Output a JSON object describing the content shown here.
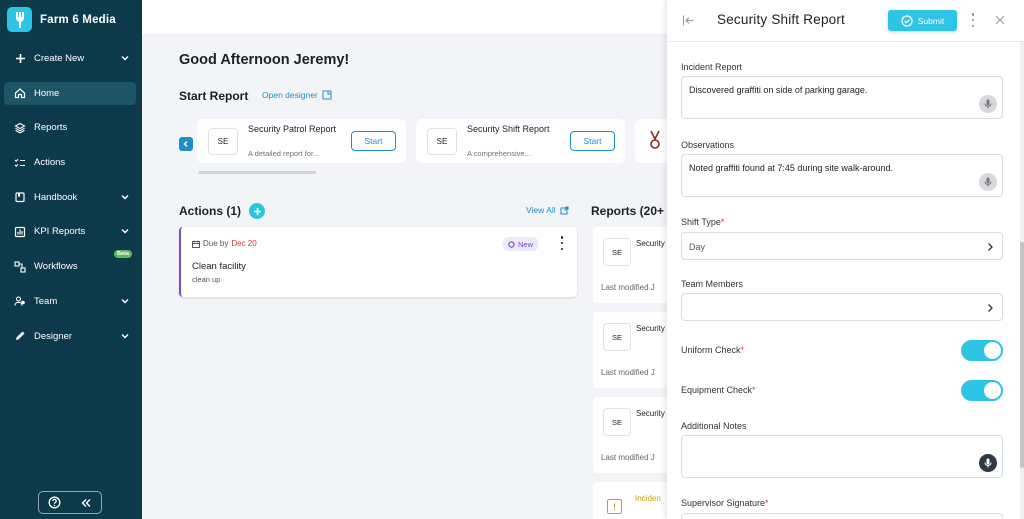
{
  "brand": {
    "name": "Farm 6 Media"
  },
  "sidebar": {
    "items": [
      {
        "label": "Create New",
        "icon": "plus-icon",
        "has_chevron": true
      },
      {
        "label": "Home",
        "icon": "home-icon",
        "active": true
      },
      {
        "label": "Reports",
        "icon": "layers-icon"
      },
      {
        "label": "Actions",
        "icon": "checklist-icon"
      },
      {
        "label": "Handbook",
        "icon": "book-icon",
        "has_chevron": true
      },
      {
        "label": "KPI Reports",
        "icon": "chart-icon",
        "has_chevron": true
      },
      {
        "label": "Workflows",
        "icon": "workflow-icon",
        "badge": "Beta"
      },
      {
        "label": "Team",
        "icon": "team-icon",
        "has_chevron": true
      },
      {
        "label": "Designer",
        "icon": "pencil-icon",
        "has_chevron": true
      }
    ]
  },
  "main": {
    "greeting": "Good Afternoon Jeremy!",
    "start_report": {
      "heading": "Start Report",
      "open_designer": "Open designer",
      "cards": [
        {
          "badge": "SE",
          "title": "Security Patrol Report",
          "desc": "A detailed report for...",
          "button": "Start"
        },
        {
          "badge": "SE",
          "title": "Security Shift Report",
          "desc": "A comprehensive...",
          "button": "Start"
        }
      ]
    },
    "actions": {
      "heading": "Actions (1)",
      "view_all": "View All",
      "card": {
        "due_prefix": "Due by",
        "due_date": "Dec 20",
        "status": "New",
        "title": "Clean facility",
        "subtitle": "clean up"
      }
    },
    "reports": {
      "heading": "Reports (20+",
      "cards": [
        {
          "badge": "SE",
          "title": "Security",
          "modified": "Last modified J"
        },
        {
          "badge": "SE",
          "title": "Security",
          "modified": "Last modified J"
        },
        {
          "badge": "SE",
          "title": "Security",
          "modified": "Last modified J"
        }
      ],
      "incident": {
        "title": "Inciden"
      }
    }
  },
  "panel": {
    "title": "Security Shift Report",
    "submit": "Submit",
    "incident_report": {
      "label": "Incident Report",
      "value": "Discovered graffiti on side of parking garage."
    },
    "observations": {
      "label": "Observations",
      "value": "Noted graffiti found at 7:45 during site walk-around."
    },
    "shift_type": {
      "label": "Shift Type",
      "value": "Day"
    },
    "team_members": {
      "label": "Team Members",
      "value": ""
    },
    "uniform_check": {
      "label": "Uniform Check",
      "on": true
    },
    "equipment_check": {
      "label": "Equipment Check",
      "on": true
    },
    "additional_notes": {
      "label": "Additional Notes",
      "value": ""
    },
    "supervisor_signature": {
      "label": "Supervisor Signature"
    },
    "required_mark": "*"
  },
  "colors": {
    "sidebar": "#0d3a4a",
    "accent": "#2ec4e6",
    "link": "#1f8fcb",
    "active_nav": "#1e5566"
  }
}
